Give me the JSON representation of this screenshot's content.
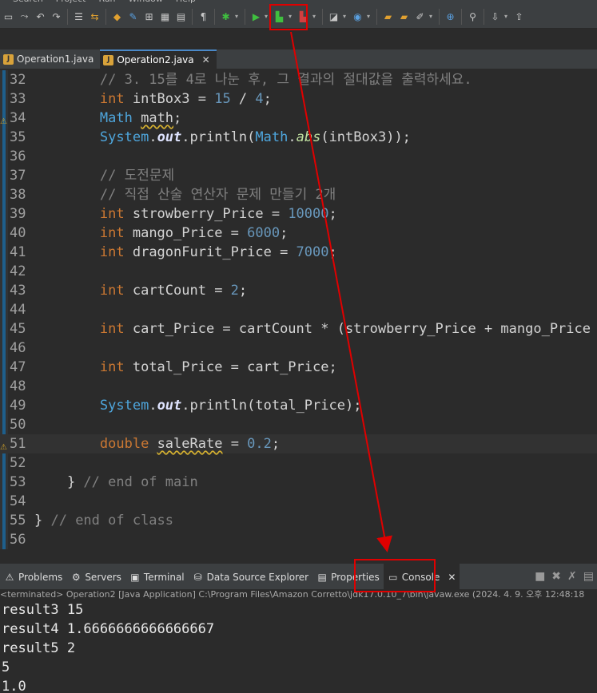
{
  "menu": [
    "Search",
    "Project",
    "Run",
    "Window",
    "Help"
  ],
  "toolbar": {
    "icons": [
      "new-icon",
      "save-icon",
      "print-icon",
      "undo-icon",
      "redo-icon",
      "build-icon",
      "format-icon",
      "git-icon",
      "highlight-icon",
      "toggle-breadcrumb-icon",
      "task-icon",
      "debug-icon",
      "run-icon",
      "coverage-icon",
      "external-tools-icon",
      "new-java-project-icon",
      "new-class-icon",
      "open-type-icon",
      "open-task-icon",
      "search-icon",
      "next-annotation-icon"
    ]
  },
  "editor_tabs": [
    {
      "label": "Operation1.java",
      "active": false
    },
    {
      "label": "Operation2.java",
      "active": true
    }
  ],
  "code_lines": [
    {
      "n": "32",
      "html": "        <span class='cm'>// 3. 15를 4로 나눈 후, 그 결과의 절대값을 출력하세요.</span>"
    },
    {
      "n": "33",
      "html": "        <span class='kw'>int</span> intBox3 = <span class='num'>15</span> / <span class='num'>4</span>;"
    },
    {
      "n": "34",
      "html": "        <span class='cls'>Math</span> <span class='warn'>math</span>;",
      "marker": true
    },
    {
      "n": "35",
      "html": "        <span class='cls'>System</span>.<span class='fld'>out</span>.println(<span class='cls'>Math</span>.<span class='mth'>abs</span>(intBox3));"
    },
    {
      "n": "36",
      "html": ""
    },
    {
      "n": "37",
      "html": "        <span class='cm'>// 도전문제</span>"
    },
    {
      "n": "38",
      "html": "        <span class='cm'>// 직접 산술 연산자 문제 만들기 2개</span>"
    },
    {
      "n": "39",
      "html": "        <span class='kw'>int</span> strowberry_Price = <span class='num'>10000</span>;"
    },
    {
      "n": "40",
      "html": "        <span class='kw'>int</span> mango_Price = <span class='num'>6000</span>;"
    },
    {
      "n": "41",
      "html": "        <span class='kw'>int</span> dragonFurit_Price = <span class='num'>7000</span>;"
    },
    {
      "n": "42",
      "html": ""
    },
    {
      "n": "43",
      "html": "        <span class='kw'>int</span> cartCount = <span class='num'>2</span>;"
    },
    {
      "n": "44",
      "html": ""
    },
    {
      "n": "45",
      "html": "        <span class='kw'>int</span> cart_Price = cartCount * (strowberry_Price + mango_Price + dragonFurit_Price);"
    },
    {
      "n": "46",
      "html": ""
    },
    {
      "n": "47",
      "html": "        <span class='kw'>int</span> total_Price = cart_Price;"
    },
    {
      "n": "48",
      "html": ""
    },
    {
      "n": "49",
      "html": "        <span class='cls'>System</span>.<span class='fld'>out</span>.println(total_Price);"
    },
    {
      "n": "50",
      "html": ""
    },
    {
      "n": "51",
      "html": "        <span class='kw'>double</span> <span class='warn'>saleRate</span> = <span class='num'>0.2</span>;",
      "marker": true,
      "hl": true
    },
    {
      "n": "52",
      "html": ""
    },
    {
      "n": "53",
      "html": "    } <span class='cm'>// end of main</span>"
    },
    {
      "n": "54",
      "html": ""
    },
    {
      "n": "55",
      "html": "} <span class='cm'>// end of class</span>"
    },
    {
      "n": "56",
      "html": ""
    }
  ],
  "panel_tabs": [
    {
      "label": "Problems",
      "icon": "problems-icon",
      "glyph": "⚠"
    },
    {
      "label": "Servers",
      "icon": "servers-icon",
      "glyph": "⚙"
    },
    {
      "label": "Terminal",
      "icon": "terminal-icon",
      "glyph": "▣"
    },
    {
      "label": "Data Source Explorer",
      "icon": "data-source-icon",
      "glyph": "⛁"
    },
    {
      "label": "Properties",
      "icon": "properties-icon",
      "glyph": "▤"
    },
    {
      "label": "Console",
      "icon": "console-icon",
      "glyph": "▭",
      "active": true
    }
  ],
  "console": {
    "status": "<terminated> Operation2 [Java Application] C:\\Program Files\\Amazon Corretto\\jdk17.0.10_7\\bin\\javaw.exe  (2024. 4. 9. 오후 12:48:18",
    "lines": [
      "result3 15",
      "result4 1.6666666666666667",
      "result5 2",
      "5",
      "1.0"
    ]
  },
  "annotation": {
    "color": "#e00000"
  }
}
